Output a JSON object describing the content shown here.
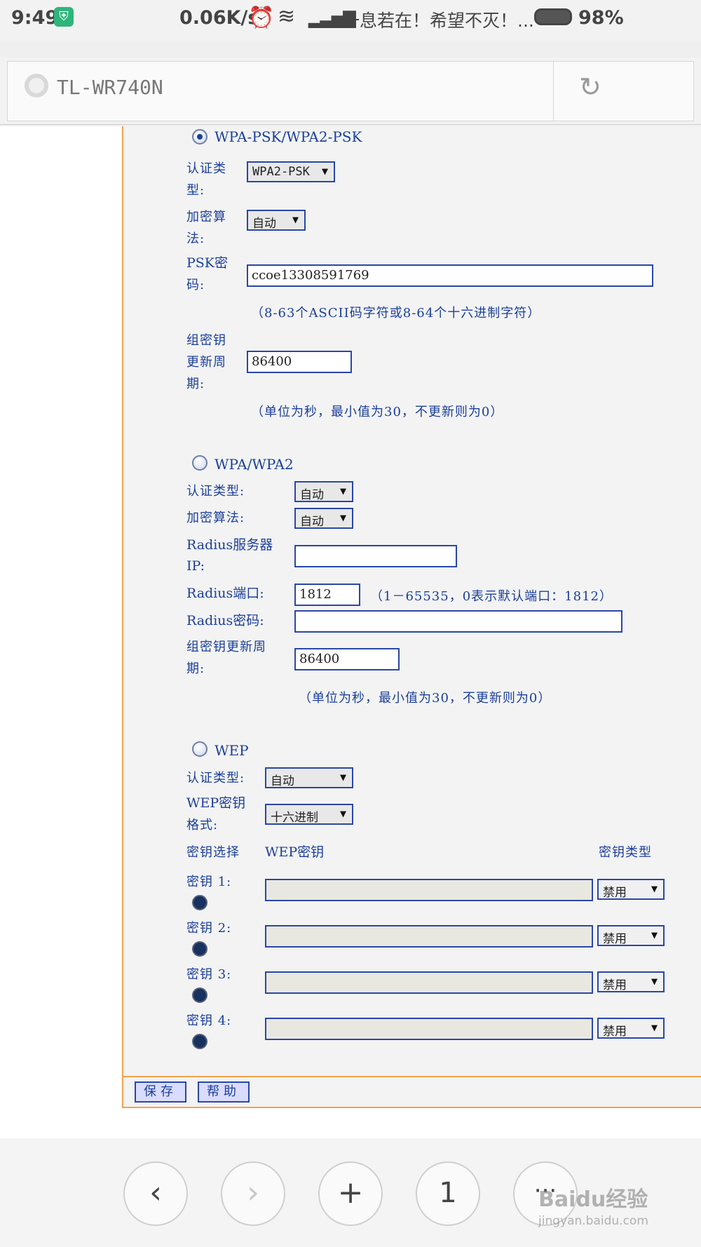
{
  "status_bar": {
    "time": "9:49",
    "speed": "0.06K/s",
    "message": "一息若在！希望不灭！...",
    "battery": "98%"
  },
  "browser": {
    "url_title": "TL-WR740N"
  },
  "wpa_psk": {
    "title": "WPA-PSK/WPA2-PSK",
    "auth_label_1": "认证类",
    "auth_label_2": "型:",
    "auth_value": "WPA2-PSK",
    "enc_label_1": "加密算",
    "enc_label_2": "法:",
    "enc_value": "自动",
    "psk_label_1": "PSK密",
    "psk_label_2": "码:",
    "psk_value": "ccoe13308591769",
    "psk_note": "（8-63个ASCII码字符或8-64个十六进制字符）",
    "rekey_label_1": "组密钥",
    "rekey_label_2": "更新周",
    "rekey_label_3": "期:",
    "rekey_value": "86400",
    "rekey_note": "（单位为秒，最小值为30，不更新则为0）"
  },
  "wpa": {
    "title": "WPA/WPA2",
    "auth_label": "认证类型:",
    "auth_value": "自动",
    "enc_label": "加密算法:",
    "enc_value": "自动",
    "radius_ip_label_1": "Radius服务器",
    "radius_ip_label_2": "IP:",
    "radius_ip_value": "",
    "radius_port_label": "Radius端口:",
    "radius_port_value": "1812",
    "radius_port_note": "（1－65535，0表示默认端口：1812）",
    "radius_pwd_label": "Radius密码:",
    "radius_pwd_value": "",
    "rekey_label_1": "组密钥更新周",
    "rekey_label_2": "期:",
    "rekey_value": "86400",
    "rekey_note": "（单位为秒，最小值为30，不更新则为0）"
  },
  "wep": {
    "title": "WEP",
    "auth_label": "认证类型:",
    "auth_value": "自动",
    "format_label_1": "WEP密钥",
    "format_label_2": "格式:",
    "format_value": "十六进制",
    "col_select": "密钥选择",
    "col_key": "WEP密钥",
    "col_type": "密钥类型",
    "keys": [
      {
        "label": "密钥 1:",
        "value": "",
        "type": "禁用"
      },
      {
        "label": "密钥 2:",
        "value": "",
        "type": "禁用"
      },
      {
        "label": "密钥 3:",
        "value": "",
        "type": "禁用"
      },
      {
        "label": "密钥 4:",
        "value": "",
        "type": "禁用"
      }
    ]
  },
  "actions": {
    "save": "保存",
    "help": "帮助"
  },
  "toolbar": {
    "back": "‹",
    "forward": "›",
    "new_tab": "+",
    "tabs_count": "1",
    "more": "···"
  },
  "watermark": {
    "brand": "Baidu经验",
    "url": "jingyan.baidu.com"
  }
}
